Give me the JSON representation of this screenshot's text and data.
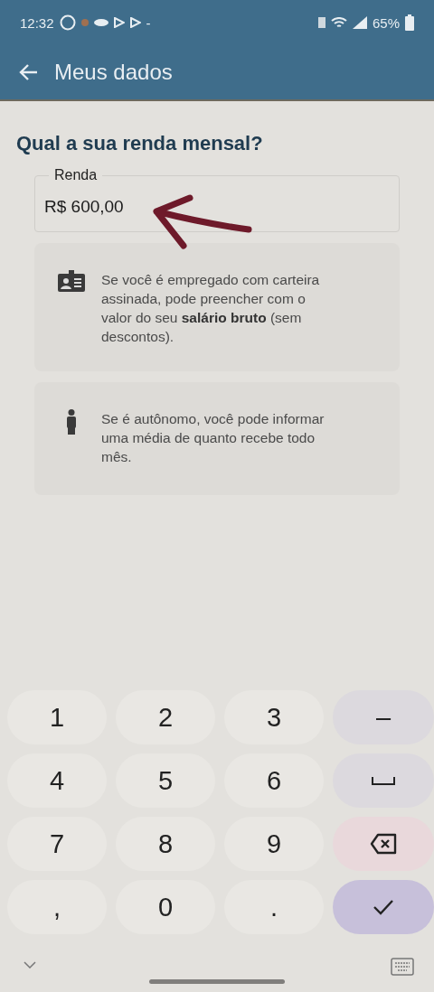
{
  "status_bar": {
    "time": "12:32",
    "separator": "-",
    "battery": "65%"
  },
  "app_bar": {
    "title": "Meus dados"
  },
  "question": "Qual a sua renda mensal?",
  "income_field": {
    "label": "Renda",
    "value": "R$ 600,00"
  },
  "hints": [
    {
      "kind": "employee",
      "text": "Se você é empregado com carteira assinada, pode preencher com o valor do seu **salário bruto** (sem descontos)."
    },
    {
      "kind": "self_employed",
      "text": "Se é autônomo, você pode informar uma média de quanto recebe todo mês."
    }
  ],
  "keypad": [
    {
      "kind": "digit",
      "label": "1"
    },
    {
      "kind": "digit",
      "label": "2"
    },
    {
      "kind": "digit",
      "label": "3"
    },
    {
      "kind": "symbol",
      "label": "–"
    },
    {
      "kind": "digit",
      "label": "4"
    },
    {
      "kind": "digit",
      "label": "5"
    },
    {
      "kind": "digit",
      "label": "6"
    },
    {
      "kind": "space"
    },
    {
      "kind": "digit",
      "label": "7"
    },
    {
      "kind": "digit",
      "label": "8"
    },
    {
      "kind": "digit",
      "label": "9"
    },
    {
      "kind": "backspace"
    },
    {
      "kind": "digit",
      "label": ","
    },
    {
      "kind": "digit",
      "label": "0"
    },
    {
      "kind": "digit",
      "label": "."
    },
    {
      "kind": "done"
    }
  ]
}
